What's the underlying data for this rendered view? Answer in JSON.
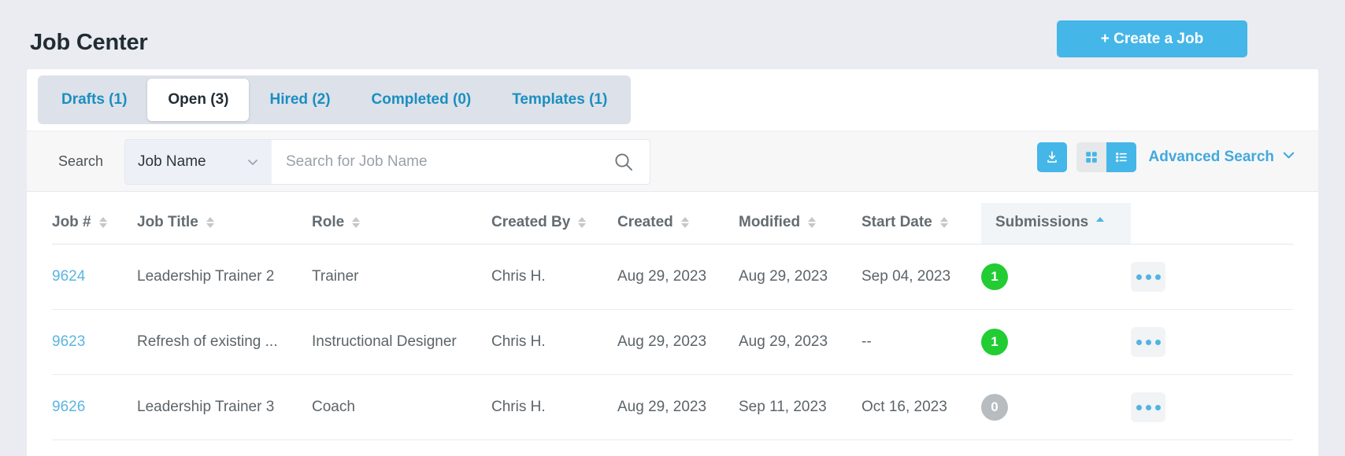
{
  "header": {
    "title": "Job Center",
    "create_button": "+ Create a Job"
  },
  "tabs": [
    {
      "label": "Drafts (1)",
      "name": "tab-drafts",
      "active": false
    },
    {
      "label": "Open (3)",
      "name": "tab-open",
      "active": true
    },
    {
      "label": "Hired (2)",
      "name": "tab-hired",
      "active": false
    },
    {
      "label": "Completed (0)",
      "name": "tab-completed",
      "active": false
    },
    {
      "label": "Templates (1)",
      "name": "tab-templates",
      "active": false
    }
  ],
  "search": {
    "label": "Search",
    "field_selector_value": "Job Name",
    "input_value": "",
    "placeholder": "Search for Job Name",
    "advanced_search_label": "Advanced Search",
    "view_mode": "list"
  },
  "table": {
    "columns": [
      {
        "label": "Job #",
        "sortable": true,
        "sorted": false
      },
      {
        "label": "Job Title",
        "sortable": true,
        "sorted": false
      },
      {
        "label": "Role",
        "sortable": true,
        "sorted": false
      },
      {
        "label": "Created By",
        "sortable": true,
        "sorted": false
      },
      {
        "label": "Created",
        "sortable": true,
        "sorted": false
      },
      {
        "label": "Modified",
        "sortable": true,
        "sorted": false
      },
      {
        "label": "Start Date",
        "sortable": true,
        "sorted": false
      },
      {
        "label": "Submissions",
        "sortable": true,
        "sorted": true,
        "sort_direction": "asc"
      },
      {
        "label": "",
        "sortable": false,
        "sorted": false
      }
    ],
    "rows": [
      {
        "job_number": "9624",
        "job_title": "Leadership Trainer 2",
        "role": "Trainer",
        "created_by": "Chris H.",
        "created": "Aug 29, 2023",
        "modified": "Aug 29, 2023",
        "start_date": "Sep 04, 2023",
        "submissions": "1",
        "submissions_state": "green"
      },
      {
        "job_number": "9623",
        "job_title": "Refresh of existing ...",
        "role": "Instructional Designer",
        "created_by": "Chris H.",
        "created": "Aug 29, 2023",
        "modified": "Aug 29, 2023",
        "start_date": "--",
        "submissions": "1",
        "submissions_state": "green"
      },
      {
        "job_number": "9626",
        "job_title": "Leadership Trainer 3",
        "role": "Coach",
        "created_by": "Chris H.",
        "created": "Aug 29, 2023",
        "modified": "Sep 11, 2023",
        "start_date": "Oct 16, 2023",
        "submissions": "0",
        "submissions_state": "gray"
      }
    ]
  },
  "colors": {
    "accent_blue": "#45b6e8",
    "link_blue": "#5bb5e0",
    "tab_blue": "#1a8fc1",
    "badge_green": "#22cc33",
    "badge_gray": "#b6bcc0",
    "page_bg": "#eaecf1"
  },
  "icons": {
    "download": "download-icon",
    "grid_view": "grid-view-icon",
    "list_view": "list-view-icon",
    "search": "search-icon",
    "chevron_down": "chevron-down-icon",
    "sort": "sort-icon",
    "kebab": "kebab-menu-icon"
  }
}
